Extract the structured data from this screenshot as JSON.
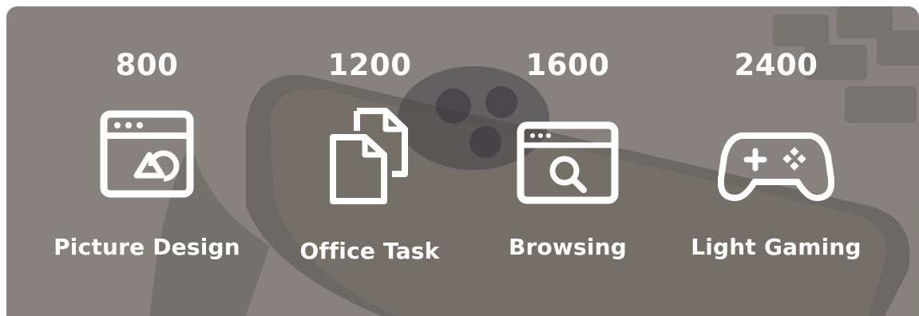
{
  "items": [
    {
      "value": "800",
      "label": "Picture Design",
      "icon": "picture-design-icon"
    },
    {
      "value": "1200",
      "label": "Office Task",
      "icon": "documents-icon"
    },
    {
      "value": "1600",
      "label": "Browsing",
      "icon": "browser-search-icon"
    },
    {
      "value": "2400",
      "label": "Light Gaming",
      "icon": "gamepad-icon"
    }
  ],
  "colors": {
    "text": "#ffffff",
    "overlay": "#8a8680"
  }
}
